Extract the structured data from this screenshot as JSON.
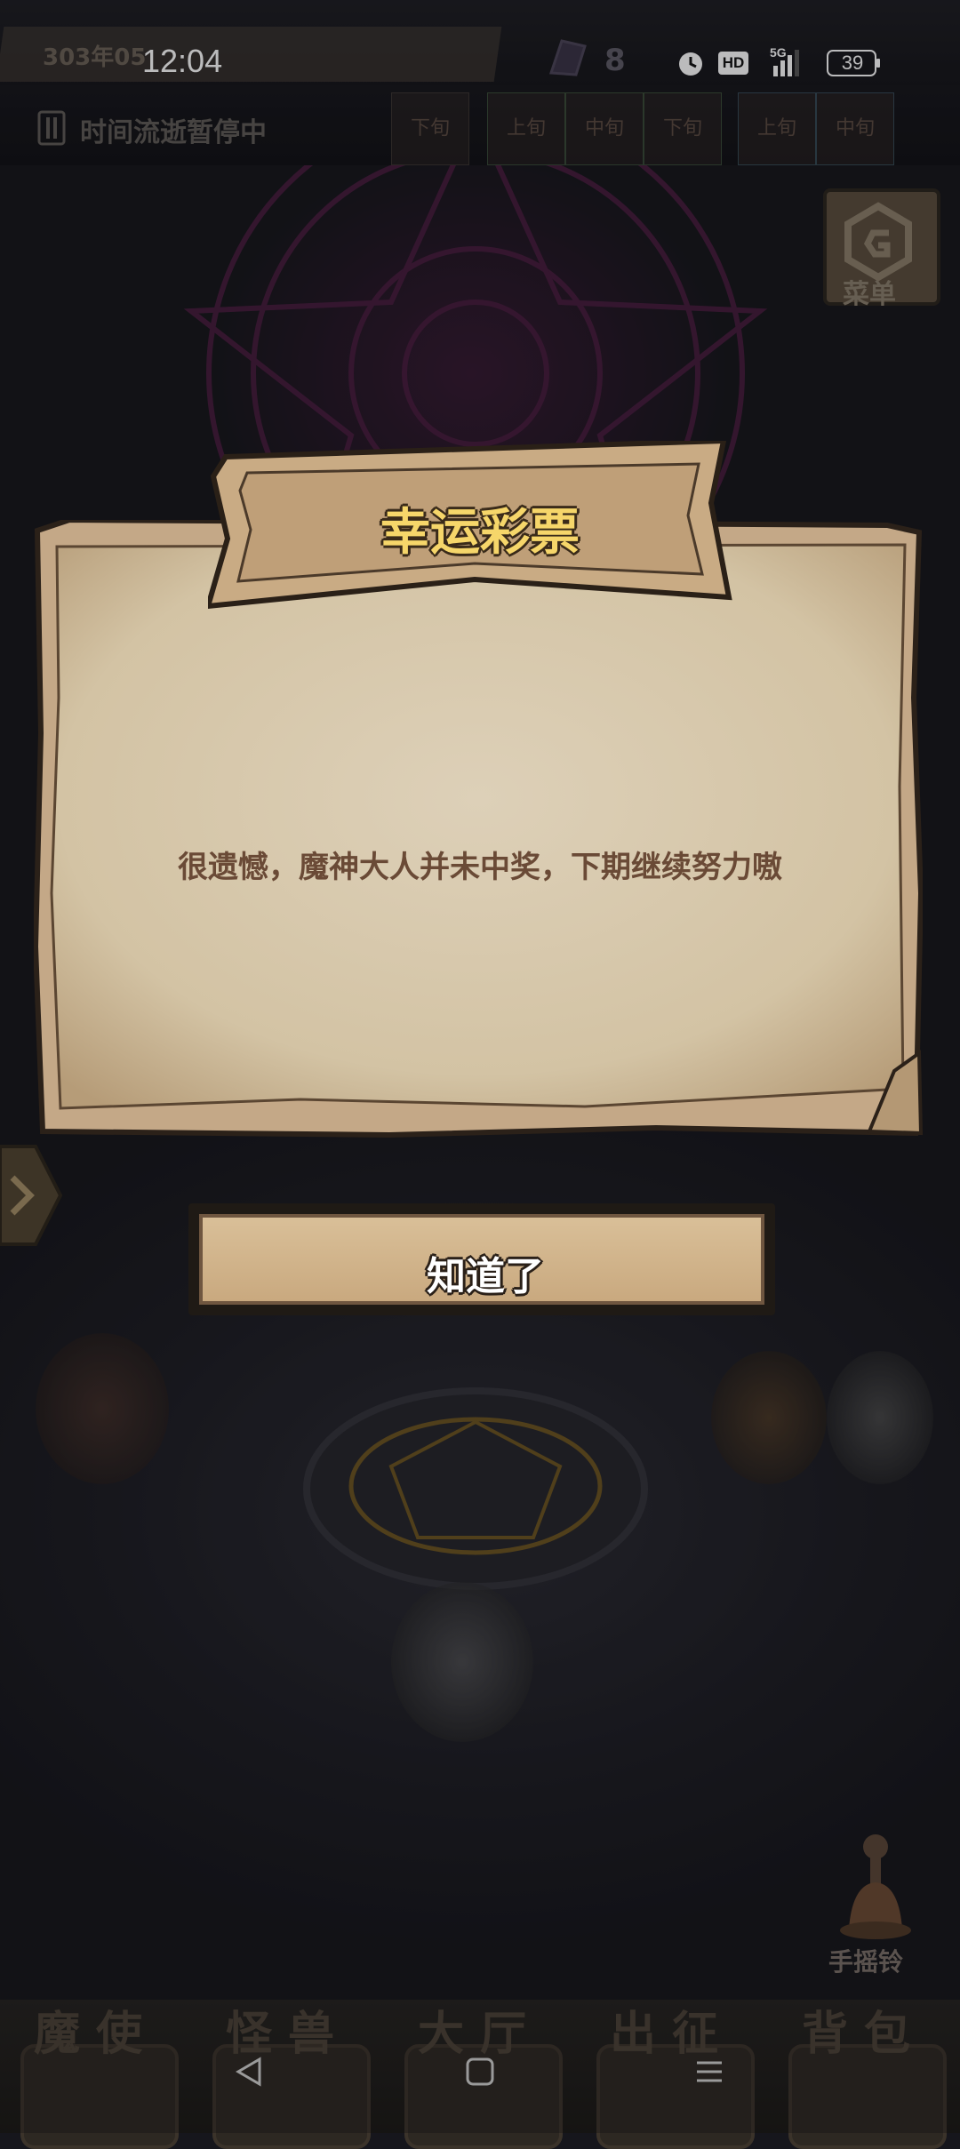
{
  "status_bar": {
    "date_partial": "303年05",
    "time": "12:04",
    "gem_count": "8",
    "network": "5G",
    "hd_label": "HD",
    "battery": "39",
    "icons": [
      "alarm-icon",
      "hd-icon",
      "signal-icon",
      "battery-icon"
    ]
  },
  "time_bar": {
    "pause_label": "时间流逝暂停中",
    "periods": [
      "下旬",
      "上旬",
      "中旬",
      "下旬",
      "上旬",
      "中旬"
    ]
  },
  "menu": {
    "label": "菜单"
  },
  "dialog": {
    "title": "幸运彩票",
    "message": "很遗憾，魔神大人并未中奖，下期继续努力嗷",
    "confirm_label": "知道了"
  },
  "bell": {
    "label": "手摇铃"
  },
  "bottom_nav": {
    "tabs": [
      {
        "label": "魔使",
        "icon": "skull-icon"
      },
      {
        "label": "怪兽",
        "icon": "monster-icon"
      },
      {
        "label": "大厅",
        "icon": "hall-icon"
      },
      {
        "label": "出征",
        "icon": "expedition-icon"
      },
      {
        "label": "背包",
        "icon": "backpack-icon"
      }
    ]
  },
  "system_nav": [
    "back-icon",
    "home-icon",
    "recents-icon"
  ],
  "colors": {
    "title_gold": "#f6d66a",
    "message_brown": "#6a4a36",
    "paper": "#e3d5bd",
    "plank": "#c4a887"
  }
}
